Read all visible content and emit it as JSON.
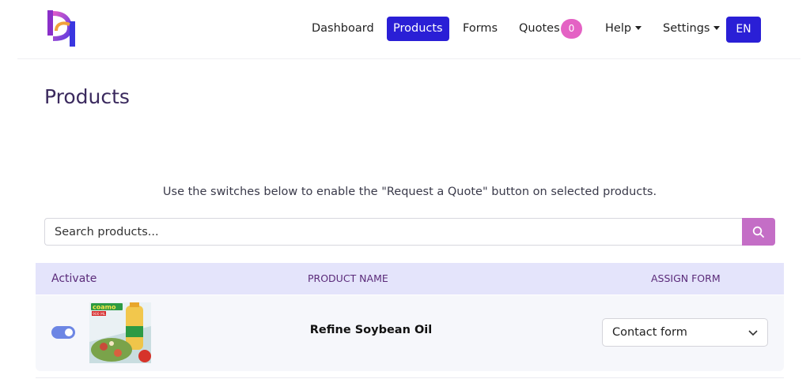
{
  "nav": {
    "links": [
      "Dashboard",
      "Products",
      "Forms",
      "Quotes"
    ],
    "quotes_badge": "0",
    "help_label": "Help",
    "settings_label": "Settings",
    "language": "EN",
    "active": "Products"
  },
  "page": {
    "title": "Products",
    "instructions": "Use the switches below to enable the \"Request a Quote\" button on selected products."
  },
  "search": {
    "placeholder": "Search products...",
    "icon": "search-icon"
  },
  "table": {
    "headers": {
      "activate": "Activate",
      "product_name": "PRODUCT NAME",
      "assign_form": "ASSIGN FORM"
    },
    "rows": [
      {
        "activated": true,
        "product_name": "Refine Soybean Oil",
        "image_text": "coamo",
        "image_subtext": "900 ML",
        "assigned_form": "Contact form"
      }
    ]
  },
  "colors": {
    "primary": "#2a1fd6",
    "badge": "#e462c4",
    "search_button": "#c46ec6",
    "table_header_bg": "#e4e4fb",
    "toggle_on": "#6d86e4"
  }
}
